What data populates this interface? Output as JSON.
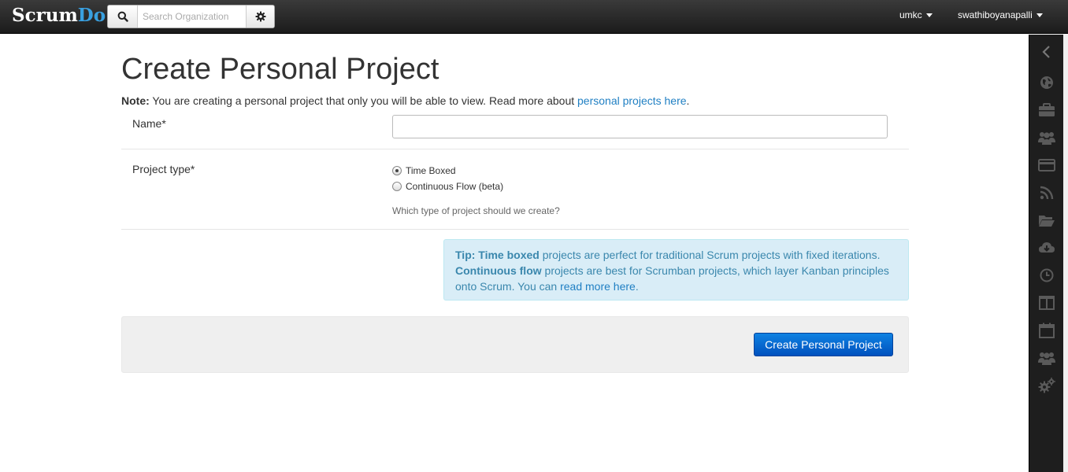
{
  "navbar": {
    "logo_part1": "Scrum",
    "logo_part2": "Do",
    "search_placeholder": "Search Organization",
    "org_menu": "umkc",
    "user_menu": "swathiboyanapalli"
  },
  "page": {
    "title": "Create Personal Project",
    "note_label": "Note:",
    "note_text": "You are creating a personal project that only you will be able to view. Read more about",
    "note_link": "personal projects here",
    "note_end": "."
  },
  "form": {
    "name_label": "Name*",
    "name_value": "",
    "type_label": "Project type*",
    "type_options": [
      {
        "label": "Time Boxed",
        "checked": true
      },
      {
        "label": "Continuous Flow (beta)",
        "checked": false
      }
    ],
    "type_help": "Which type of project should we create?"
  },
  "tip": {
    "lead": "Tip:",
    "term1": "Time boxed",
    "text1": "projects are perfect for traditional Scrum projects with fixed iterations.",
    "term2": "Continuous flow",
    "text2": "projects are best for Scrumban projects, which layer Kanban principles onto Scrum. You can",
    "link": "read more here",
    "end": "."
  },
  "actions": {
    "submit_label": "Create Personal Project"
  },
  "sidebar": {
    "icons": [
      "chevron-left-icon",
      "globe-icon",
      "briefcase-icon",
      "team-icon",
      "credit-card-icon",
      "rss-icon",
      "folder-open-icon",
      "cloud-download-icon",
      "clock-icon",
      "columns-icon",
      "calendar-icon",
      "group-icon",
      "cogs-icon"
    ]
  },
  "colors": {
    "accent": "#1f7fc3",
    "primary_button": "#0069d2",
    "tip_background": "#d9edf7",
    "navbar": "#222222"
  }
}
